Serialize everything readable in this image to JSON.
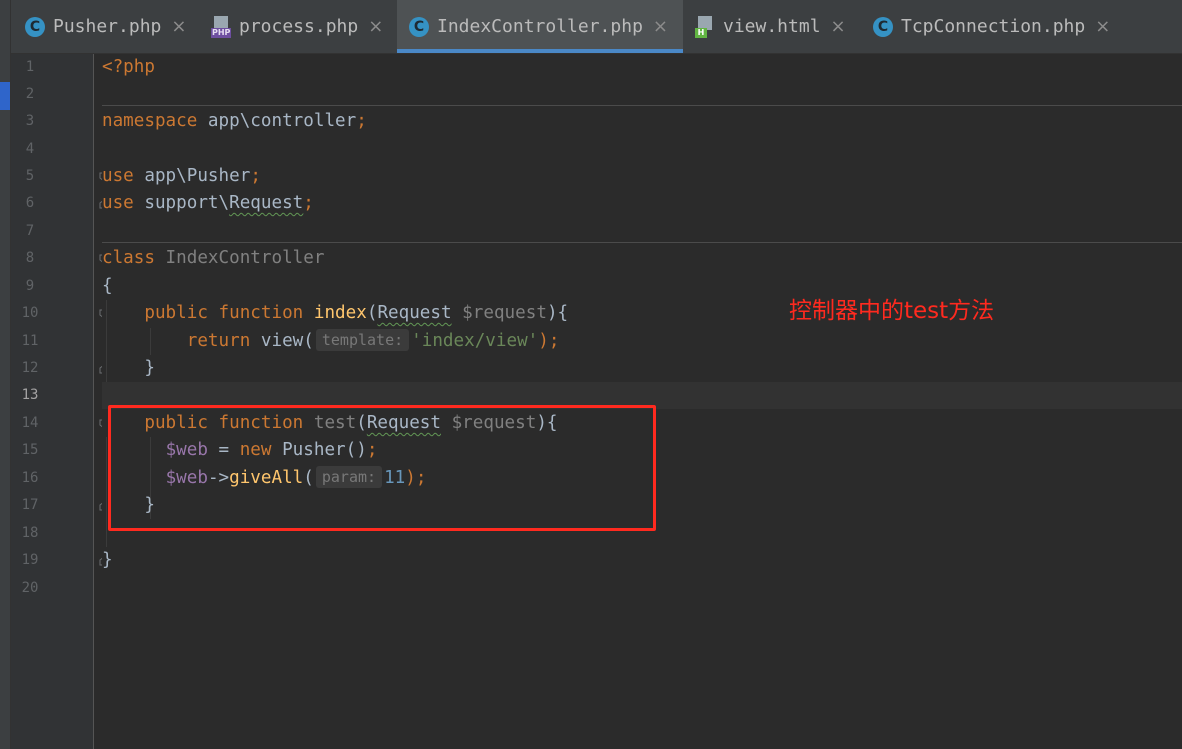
{
  "tabs": [
    {
      "label": "Pusher.php",
      "icon": "class-icon",
      "active": false
    },
    {
      "label": "process.php",
      "icon": "php-file-icon",
      "active": false
    },
    {
      "label": "IndexController.php",
      "icon": "class-icon",
      "active": true
    },
    {
      "label": "view.html",
      "icon": "html-file-icon",
      "active": false
    },
    {
      "label": "TcpConnection.php",
      "icon": "class-icon",
      "active": false
    }
  ],
  "icon_glyphs": {
    "class": "C",
    "php": "PHP",
    "html": "H",
    "close": "×"
  },
  "line_numbers": [
    "1",
    "2",
    "3",
    "4",
    "5",
    "6",
    "7",
    "8",
    "9",
    "10",
    "11",
    "12",
    "13",
    "14",
    "15",
    "16",
    "17",
    "18",
    "19",
    "20"
  ],
  "current_line": "13",
  "code": {
    "l1": {
      "open_tag": "<?php"
    },
    "l3": {
      "keyword": "namespace",
      "name": " app\\controller",
      "semi": ";"
    },
    "l5": {
      "keyword": "use",
      "name": " app\\Pusher",
      "semi": ";"
    },
    "l6": {
      "keyword": "use",
      "name_a": " support\\",
      "name_b": "Request",
      "semi": ";"
    },
    "l8": {
      "keyword": "class",
      "name": " IndexController"
    },
    "l9": {
      "brace": "{"
    },
    "l10": {
      "indent": "    ",
      "kw1": "public",
      "kw2": " function",
      "fname": " index",
      "p1": "(",
      "type": "Request",
      "var": " $request",
      "p2": "){"
    },
    "l11": {
      "indent": "        ",
      "kw": "return",
      "call": " view(",
      "hint": "template:",
      "str": "'index/view'",
      "end": ");"
    },
    "l12": {
      "text": "    }"
    },
    "l14": {
      "indent": "    ",
      "kw1": "public",
      "kw2": " function",
      "fname": " test",
      "p1": "(",
      "type": "Request",
      "var": " $request",
      "p2": "){"
    },
    "l15": {
      "indent": "      ",
      "var": "$web",
      "op": " = ",
      "kw": "new",
      "cls": " Pusher()",
      "semi": ";"
    },
    "l16": {
      "indent": "      ",
      "var": "$web",
      "arrow": "->",
      "method": "giveAll",
      "p1": "(",
      "hint": "param:",
      "num": "11",
      "end": ");"
    },
    "l17": {
      "text": "    }"
    },
    "l19": {
      "brace": "}"
    }
  },
  "annotation": "控制器中的test方法",
  "colors": {
    "annotation": "#ff2a1f",
    "keyword": "#cc7832",
    "function": "#ffc66d",
    "string": "#6a8759",
    "number": "#6897bb",
    "variable": "#9876aa",
    "text": "#a9b7c6",
    "tab_underline": "#4a88c7"
  }
}
